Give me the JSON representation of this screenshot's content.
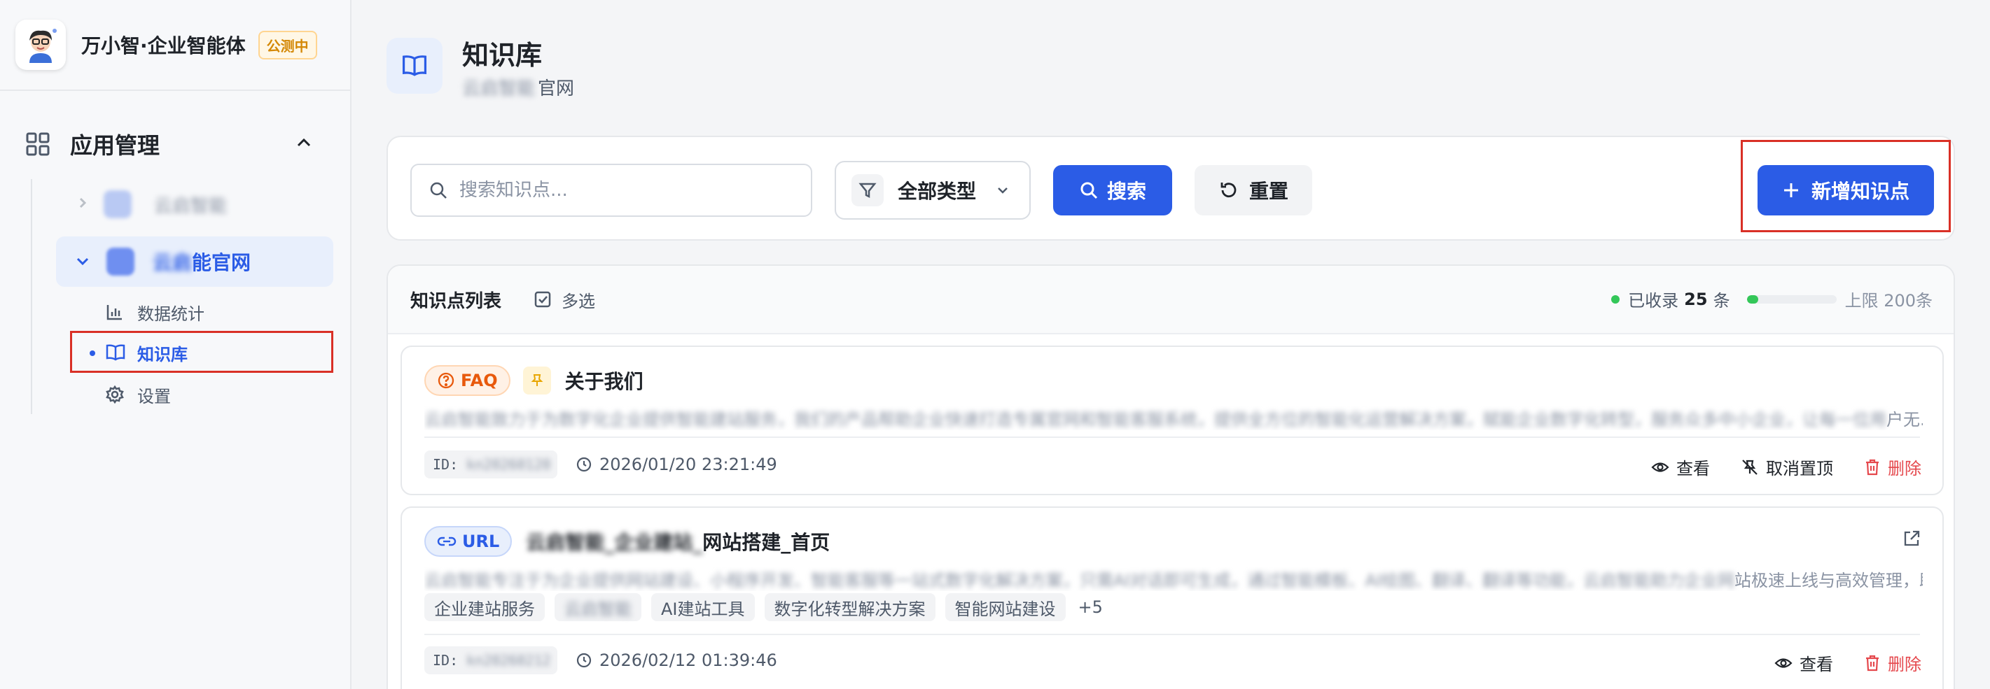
{
  "brand": {
    "title": "万小智·企业智能体",
    "badge": "公测中",
    "logo_icon": "avatar-icon"
  },
  "sidebar": {
    "group_label": "应用管理",
    "apps": [
      {
        "label": "云启智能"
      },
      {
        "label_blurred": "云启",
        "label_visible": "能官网"
      }
    ],
    "sub_items": [
      {
        "label": "数据统计",
        "icon": "bar-chart-icon"
      },
      {
        "label": "知识库",
        "icon": "book-icon"
      },
      {
        "label": "设置",
        "icon": "gear-icon"
      }
    ]
  },
  "header": {
    "title": "知识库",
    "subtitle_blurred": "云启智能",
    "subtitle_visible": "官网"
  },
  "toolbar": {
    "search_placeholder": "搜索知识点...",
    "type_filter": "全部类型",
    "search_label": "搜索",
    "reset_label": "重置",
    "add_label": "新增知识点"
  },
  "list": {
    "title": "知识点列表",
    "multi_select": "多选",
    "collected_prefix": "已收录",
    "collected_count": "25",
    "collected_suffix": "条",
    "progress_fraction": 0.125,
    "limit_text": "上限 200条",
    "cards": [
      {
        "type": "FAQ",
        "title": "关于我们",
        "desc_blurred": "云启智能致力于为数字化企业提供智能建站服务，我们的产品帮助企业快速打造专属官网和智能客服系统，提供全方位的智能化运营解决方案，赋能企业数字化转型，服务众多中小企业，让每一位用",
        "desc_visible": "户无...",
        "id_prefix": "ID:",
        "id_blurred": "kn20260120",
        "time": "2026/01/20 23:21:49",
        "actions": [
          "查看",
          "取消置顶",
          "删除"
        ]
      },
      {
        "type": "URL",
        "title_blurred": "云启智能_企业建站_",
        "title_visible": "网站搭建_首页",
        "desc_blurred": "云启智能专注于为企业提供网站建设、小程序开发、智能客服等一站式数字化解决方案，只需AI对话即可生成，通过智能模板、AI绘图、翻译、翻译等功能，云启智能助力企业网",
        "desc_visible": "站极速上线与高效管理，助...",
        "tags": [
          "企业建站服务",
          "云启智能",
          "AI建站工具",
          "数字化转型解决方案",
          "智能网站建设",
          "+5"
        ],
        "id_prefix": "ID:",
        "id_blurred": "kn20260212",
        "time": "2026/02/12 01:39:46",
        "actions": [
          "查看",
          "删除"
        ]
      }
    ]
  },
  "colors": {
    "primary": "#2b5ce6",
    "danger": "#e5484d",
    "success": "#34c759",
    "faq": "#e8590c"
  }
}
